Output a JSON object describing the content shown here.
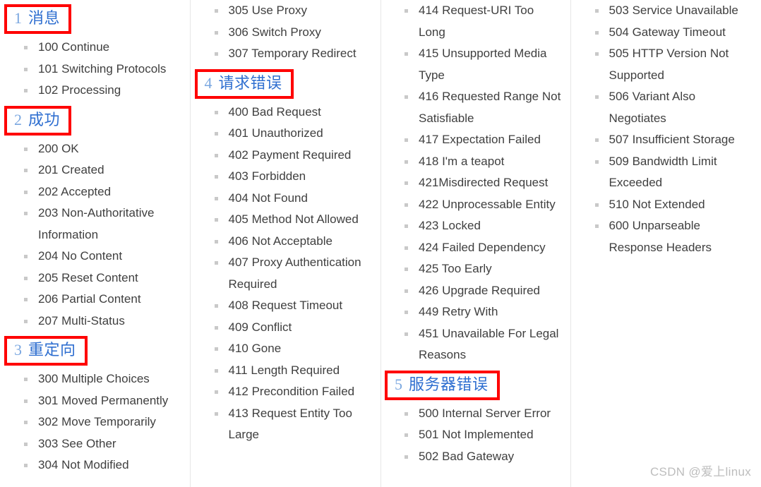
{
  "page": {
    "watermark": "CSDN @爱上linux"
  },
  "flow": [
    {
      "kind": "heading",
      "num": "1",
      "text": "消息"
    },
    {
      "kind": "item",
      "text": "100 Continue"
    },
    {
      "kind": "item",
      "text": "101 Switching Protocols"
    },
    {
      "kind": "item",
      "text": "102 Processing"
    },
    {
      "kind": "heading",
      "num": "2",
      "text": "成功"
    },
    {
      "kind": "item",
      "text": "200 OK"
    },
    {
      "kind": "item",
      "text": "201 Created"
    },
    {
      "kind": "item",
      "text": "202 Accepted"
    },
    {
      "kind": "item",
      "text": "203 Non-Authoritative Information"
    },
    {
      "kind": "item",
      "text": "204 No Content"
    },
    {
      "kind": "item",
      "text": "205 Reset Content"
    },
    {
      "kind": "item",
      "text": "206 Partial Content"
    },
    {
      "kind": "item",
      "text": "207 Multi-Status"
    },
    {
      "kind": "heading",
      "num": "3",
      "text": "重定向"
    },
    {
      "kind": "item",
      "text": "300 Multiple Choices"
    },
    {
      "kind": "item",
      "text": "301 Moved Permanently"
    },
    {
      "kind": "item",
      "text": "302 Move Temporarily"
    },
    {
      "kind": "item",
      "text": "303 See Other"
    },
    {
      "kind": "item",
      "text": "304 Not Modified"
    },
    {
      "kind": "item",
      "text": "305 Use Proxy"
    },
    {
      "kind": "item",
      "text": "306 Switch Proxy"
    },
    {
      "kind": "item",
      "text": "307 Temporary Redirect"
    },
    {
      "kind": "heading",
      "num": "4",
      "text": "请求错误"
    },
    {
      "kind": "item",
      "text": "400 Bad Request"
    },
    {
      "kind": "item",
      "text": "401 Unauthorized"
    },
    {
      "kind": "item",
      "text": "402 Payment Required"
    },
    {
      "kind": "item",
      "text": "403 Forbidden"
    },
    {
      "kind": "item",
      "text": "404 Not Found"
    },
    {
      "kind": "item",
      "text": "405 Method Not Allowed"
    },
    {
      "kind": "item",
      "text": "406 Not Acceptable"
    },
    {
      "kind": "item",
      "text": "407 Proxy Authentication Required"
    },
    {
      "kind": "item",
      "text": "408 Request Timeout"
    },
    {
      "kind": "item",
      "text": "409 Conflict"
    },
    {
      "kind": "item",
      "text": "410 Gone"
    },
    {
      "kind": "item",
      "text": "411 Length Required"
    },
    {
      "kind": "item",
      "text": "412 Precondition Failed"
    },
    {
      "kind": "item",
      "text": "413 Request Entity Too Large"
    },
    {
      "kind": "item",
      "text": "414 Request-URI Too Long"
    },
    {
      "kind": "item",
      "text": "415 Unsupported Media Type"
    },
    {
      "kind": "item",
      "text": "416 Requested Range Not Satisfiable"
    },
    {
      "kind": "item",
      "text": "417 Expectation Failed"
    },
    {
      "kind": "item",
      "text": "418 I'm a teapot"
    },
    {
      "kind": "item",
      "text": "421Misdirected Request"
    },
    {
      "kind": "item",
      "text": "422 Unprocessable Entity"
    },
    {
      "kind": "item",
      "text": "423 Locked"
    },
    {
      "kind": "item",
      "text": "424 Failed Dependency"
    },
    {
      "kind": "item",
      "text": "425 Too Early"
    },
    {
      "kind": "item",
      "text": "426 Upgrade Required"
    },
    {
      "kind": "item",
      "text": "449 Retry With"
    },
    {
      "kind": "item",
      "text": "451 Unavailable For Legal Reasons"
    },
    {
      "kind": "heading",
      "num": "5",
      "text": "服务器错误"
    },
    {
      "kind": "item",
      "text": "500 Internal Server Error"
    },
    {
      "kind": "item",
      "text": "501 Not Implemented"
    },
    {
      "kind": "item",
      "text": "502 Bad Gateway"
    },
    {
      "kind": "item",
      "text": "503 Service Unavailable"
    },
    {
      "kind": "item",
      "text": "504 Gateway Timeout"
    },
    {
      "kind": "item",
      "text": "505 HTTP Version Not Supported"
    },
    {
      "kind": "item",
      "text": "506 Variant Also Negotiates"
    },
    {
      "kind": "item",
      "text": "507 Insufficient Storage"
    },
    {
      "kind": "item",
      "text": "509 Bandwidth Limit Exceeded"
    },
    {
      "kind": "item",
      "text": "510 Not Extended"
    },
    {
      "kind": "item",
      "text": "600 Unparseable Response Headers"
    }
  ],
  "colors": {
    "heading_box": "#ff0000",
    "heading_text": "#2f6fd0",
    "heading_number": "#7aa7e0",
    "body_text": "#3f3f3f",
    "bullet": "#c9c9c9",
    "column_rule": "#e6e6e6",
    "watermark": "#bdbdbd"
  }
}
